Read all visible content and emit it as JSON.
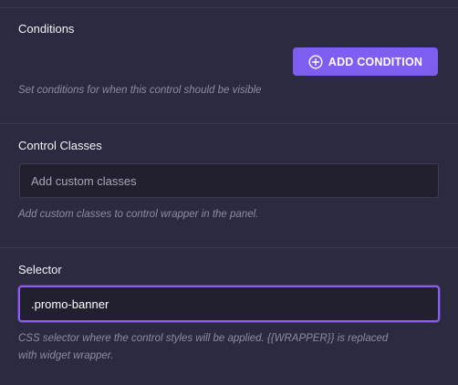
{
  "conditions": {
    "label": "Conditions",
    "add_button_label": "ADD CONDITION",
    "add_button_icon": "plus-circle-icon",
    "hint": "Set conditions for when this control should be visible"
  },
  "control_classes": {
    "label": "Control Classes",
    "input_value": "",
    "input_placeholder": "Add custom classes",
    "hint": "Add custom classes to control wrapper in the panel."
  },
  "selector": {
    "label": "Selector",
    "input_value": ".promo-banner",
    "input_placeholder": "",
    "hint_line1": "CSS selector where the control styles will be applied. {{WRAPPER}} is replaced",
    "hint_line2": "with widget wrapper."
  },
  "colors": {
    "background": "#2c2a40",
    "accent": "#7e5ef0",
    "focus_border": "#8a5ef4",
    "input_background": "#22202f",
    "hint_text": "#8e8ca3"
  }
}
